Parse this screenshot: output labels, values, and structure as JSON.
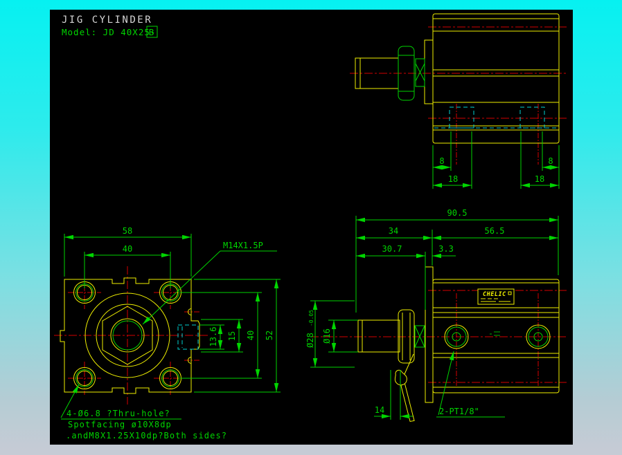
{
  "header": {
    "title": "JIG CYLINDER",
    "model_prefix": "Model: JD 40X25-",
    "model_boxed": "B"
  },
  "nameplate": {
    "brand": "CHELIC"
  },
  "labels": {
    "thread": "M14X1.5P",
    "ports": "2-PT1/8\""
  },
  "dims": {
    "top_view": {
      "d8_left": "8",
      "d18_left": "18",
      "d8_right": "8",
      "d18_right": "18"
    },
    "side_view": {
      "d905": "90.5",
      "d34": "34",
      "d565": "56.5",
      "d307": "30.7",
      "d33": "3.3",
      "dia28": "Ø28",
      "dia28_tol": "-0.05",
      "dia16": "Ø16",
      "d14": "14"
    },
    "front_view": {
      "d58": "58",
      "d40_top": "40",
      "d136": "13.6",
      "d15": "15",
      "d40_right": "40",
      "d52": "52"
    }
  },
  "notes": {
    "line1": "4-Ø6.8 ?Thru-hole?",
    "line2": "Spotfacing ø10X8dp",
    "line3": ".andM8X1.25X10dp?Both sides?"
  },
  "colors": {
    "canvas": "#000000",
    "outline_yellow": "#f0f000",
    "dimension_green": "#00d500",
    "centerline_red": "#d40000",
    "hidden_cyan": "#00d2d2",
    "title_gray": "#d6d6d6",
    "background_top": "#06f1f1",
    "background_bottom": "#c7cbd5"
  }
}
